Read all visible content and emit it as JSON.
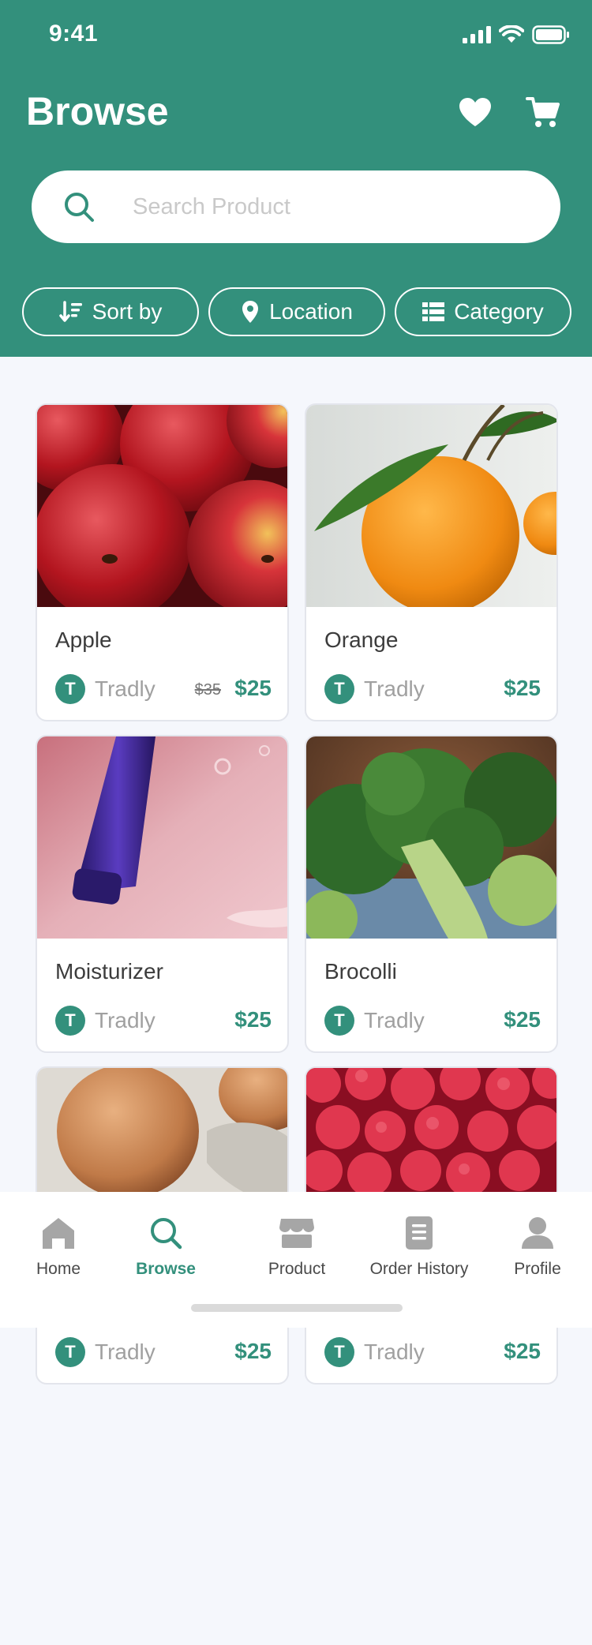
{
  "status_bar": {
    "time": "9:41"
  },
  "header": {
    "title": "Browse"
  },
  "search": {
    "placeholder": "Search Product",
    "value": ""
  },
  "filters": [
    {
      "label": "Sort by",
      "icon": "sort-icon"
    },
    {
      "label": "Location",
      "icon": "location-pin-icon"
    },
    {
      "label": "Category",
      "icon": "category-list-icon"
    }
  ],
  "products": [
    {
      "name": "Apple",
      "seller": "Tradly",
      "seller_initial": "T",
      "price": "$25",
      "old_price": "$35"
    },
    {
      "name": "Orange",
      "seller": "Tradly",
      "seller_initial": "T",
      "price": "$25"
    },
    {
      "name": "Moisturizer",
      "seller": "Tradly",
      "seller_initial": "T",
      "price": "$25"
    },
    {
      "name": "Brocolli",
      "seller": "Tradly",
      "seller_initial": "T",
      "price": "$25"
    },
    {
      "name": "",
      "seller": "Tradly",
      "seller_initial": "T",
      "price": "$25"
    },
    {
      "name": "",
      "seller": "Tradly",
      "seller_initial": "T",
      "price": "$25"
    }
  ],
  "tabbar": {
    "items": [
      {
        "label": "Home",
        "icon": "home-icon"
      },
      {
        "label": "Browse",
        "icon": "search-icon",
        "active": true
      },
      {
        "label": "Product",
        "icon": "store-icon"
      },
      {
        "label": "Order History",
        "icon": "document-icon"
      },
      {
        "label": "Profile",
        "icon": "user-icon"
      }
    ]
  },
  "colors": {
    "primary": "#33907C",
    "background": "#F5F7FC",
    "inactive_icon": "#A6A6A6"
  }
}
